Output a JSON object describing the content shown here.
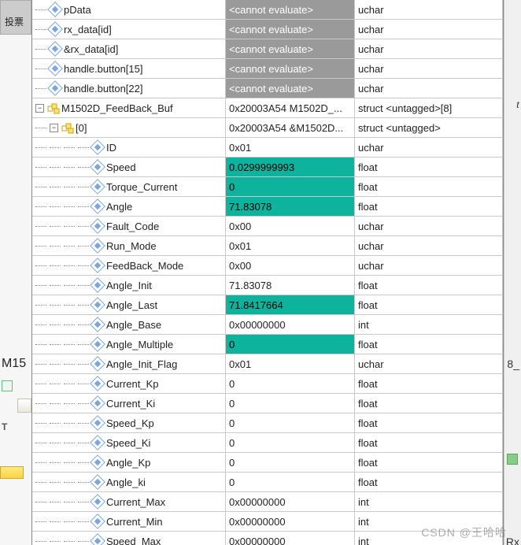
{
  "left": {
    "vote": "投票",
    "m15": "M15",
    "t_letter": "T",
    "eight": "8_",
    "rx_letter": "Rx",
    "t_top": "t"
  },
  "watermark": "CSDN @王哈哈",
  "rows": [
    {
      "depth": 1,
      "icon": "var",
      "exp": null,
      "name": "pData",
      "value": "<cannot evaluate>",
      "valClass": "grey-val",
      "type": "uchar"
    },
    {
      "depth": 1,
      "icon": "var",
      "exp": null,
      "name": "rx_data[id]",
      "value": "<cannot evaluate>",
      "valClass": "grey-val",
      "type": "uchar"
    },
    {
      "depth": 1,
      "icon": "var",
      "exp": null,
      "name": "&rx_data[id]",
      "value": "<cannot evaluate>",
      "valClass": "grey-val",
      "type": "uchar"
    },
    {
      "depth": 1,
      "icon": "var",
      "exp": null,
      "name": "handle.button[15]",
      "value": "<cannot evaluate>",
      "valClass": "grey-val",
      "type": "uchar"
    },
    {
      "depth": 1,
      "icon": "var",
      "exp": null,
      "name": "handle.button[22]",
      "value": "<cannot evaluate>",
      "valClass": "grey-val",
      "type": "uchar"
    },
    {
      "depth": 0,
      "icon": "struct",
      "exp": "-",
      "name": "M1502D_FeedBack_Buf",
      "value": "0x20003A54 M1502D_...",
      "valClass": "",
      "type": "struct <untagged>[8]"
    },
    {
      "depth": 1,
      "icon": "struct",
      "exp": "-",
      "name": "[0]",
      "value": "0x20003A54 &M1502D...",
      "valClass": "",
      "type": "struct <untagged>"
    },
    {
      "depth": 3,
      "icon": "var",
      "exp": null,
      "name": "ID",
      "value": "0x01",
      "valClass": "",
      "type": "uchar"
    },
    {
      "depth": 3,
      "icon": "var",
      "exp": null,
      "name": "Speed",
      "value": "0.0299999993",
      "valClass": "teal-val",
      "type": "float"
    },
    {
      "depth": 3,
      "icon": "var",
      "exp": null,
      "name": "Torque_Current",
      "value": "0",
      "valClass": "teal-val",
      "type": "float"
    },
    {
      "depth": 3,
      "icon": "var",
      "exp": null,
      "name": "Angle",
      "value": "71.83078",
      "valClass": "teal-val",
      "type": "float"
    },
    {
      "depth": 3,
      "icon": "var",
      "exp": null,
      "name": "Fault_Code",
      "value": "0x00",
      "valClass": "",
      "type": "uchar"
    },
    {
      "depth": 3,
      "icon": "var",
      "exp": null,
      "name": "Run_Mode",
      "value": "0x01",
      "valClass": "",
      "type": "uchar"
    },
    {
      "depth": 3,
      "icon": "var",
      "exp": null,
      "name": "FeedBack_Mode",
      "value": "0x00",
      "valClass": "",
      "type": "uchar"
    },
    {
      "depth": 3,
      "icon": "var",
      "exp": null,
      "name": "Angle_Init",
      "value": "71.83078",
      "valClass": "",
      "type": "float"
    },
    {
      "depth": 3,
      "icon": "var",
      "exp": null,
      "name": "Angle_Last",
      "value": "71.8417664",
      "valClass": "teal-val",
      "type": "float"
    },
    {
      "depth": 3,
      "icon": "var",
      "exp": null,
      "name": "Angle_Base",
      "value": "0x00000000",
      "valClass": "",
      "type": "int"
    },
    {
      "depth": 3,
      "icon": "var",
      "exp": null,
      "name": "Angle_Multiple",
      "value": "0",
      "valClass": "teal-val",
      "type": "float"
    },
    {
      "depth": 3,
      "icon": "var",
      "exp": null,
      "name": "Angle_Init_Flag",
      "value": "0x01",
      "valClass": "",
      "type": "uchar"
    },
    {
      "depth": 3,
      "icon": "var",
      "exp": null,
      "name": "Current_Kp",
      "value": "0",
      "valClass": "",
      "type": "float"
    },
    {
      "depth": 3,
      "icon": "var",
      "exp": null,
      "name": "Current_Ki",
      "value": "0",
      "valClass": "",
      "type": "float"
    },
    {
      "depth": 3,
      "icon": "var",
      "exp": null,
      "name": "Speed_Kp",
      "value": "0",
      "valClass": "",
      "type": "float"
    },
    {
      "depth": 3,
      "icon": "var",
      "exp": null,
      "name": "Speed_Ki",
      "value": "0",
      "valClass": "",
      "type": "float"
    },
    {
      "depth": 3,
      "icon": "var",
      "exp": null,
      "name": "Angle_Kp",
      "value": "0",
      "valClass": "",
      "type": "float"
    },
    {
      "depth": 3,
      "icon": "var",
      "exp": null,
      "name": "Angle_ki",
      "value": "0",
      "valClass": "",
      "type": "float"
    },
    {
      "depth": 3,
      "icon": "var",
      "exp": null,
      "name": "Current_Max",
      "value": "0x00000000",
      "valClass": "",
      "type": "int"
    },
    {
      "depth": 3,
      "icon": "var",
      "exp": null,
      "name": "Current_Min",
      "value": "0x00000000",
      "valClass": "",
      "type": "int"
    },
    {
      "depth": 3,
      "icon": "var",
      "exp": null,
      "name": "Speed_Max",
      "value": "0x00000000",
      "valClass": "",
      "type": "int"
    }
  ]
}
